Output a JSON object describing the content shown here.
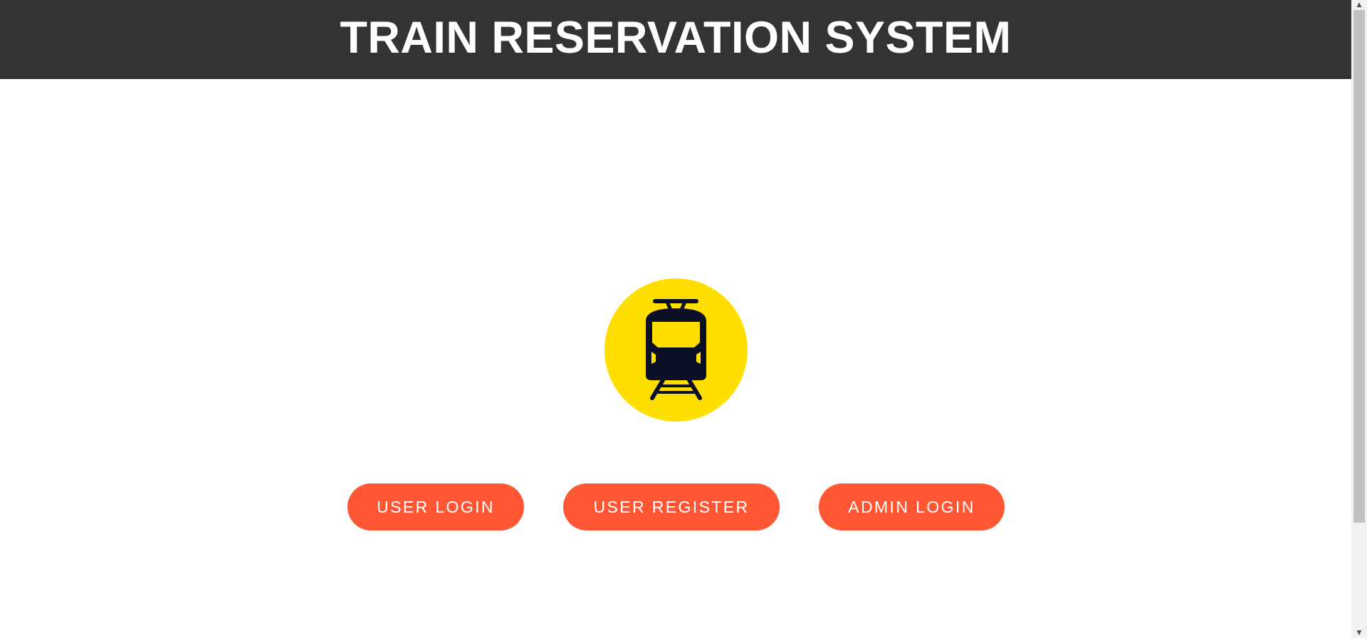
{
  "header": {
    "title": "TRAIN RESERVATION SYSTEM"
  },
  "logo": {
    "icon": "train-icon",
    "circle_color": "#FFDF00",
    "icon_color": "#0B1026"
  },
  "buttons": {
    "user_login": "USER LOGIN",
    "user_register": "USER REGISTER",
    "admin_login": "ADMIN LOGIN",
    "color": "#FF5733"
  },
  "colors": {
    "header_bg": "#333333",
    "page_bg": "#FFFFFF"
  },
  "scrollbar": {
    "up_arrow": "▲",
    "down_arrow": "▼"
  }
}
